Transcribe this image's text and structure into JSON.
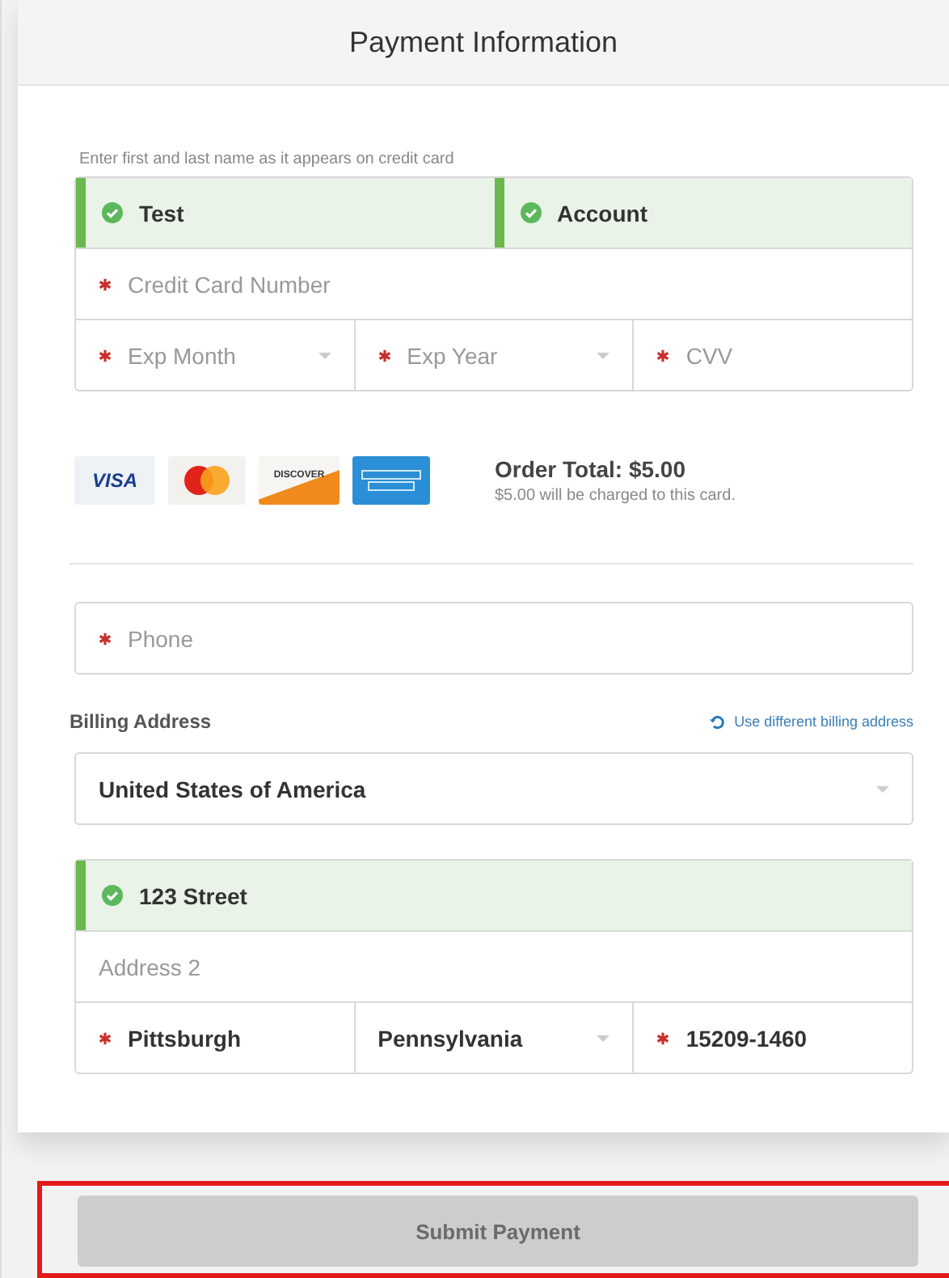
{
  "title": "Payment Information",
  "name_hint": "Enter first and last name as it appears on credit card",
  "card_rows": [
    [
      {
        "value": "Test",
        "required": false,
        "valid": true,
        "dropdown": false
      },
      {
        "value": "Account",
        "required": false,
        "valid": true,
        "dropdown": false
      }
    ],
    [
      {
        "placeholder": "Credit Card Number",
        "required": true,
        "valid": false,
        "dropdown": false
      }
    ],
    [
      {
        "placeholder": "Exp Month",
        "required": true,
        "valid": false,
        "dropdown": true
      },
      {
        "placeholder": "Exp Year",
        "required": true,
        "valid": false,
        "dropdown": true
      },
      {
        "placeholder": "CVV",
        "required": true,
        "valid": false,
        "dropdown": false
      }
    ]
  ],
  "card_logos": [
    {
      "kind": "visa",
      "label": "VISA"
    },
    {
      "kind": "mastercard"
    },
    {
      "kind": "discover",
      "label": "DISCOVER"
    },
    {
      "kind": "amex"
    }
  ],
  "order_total": "Order Total: $5.00",
  "charge_note": "$5.00 will be charged to this card.",
  "phone": {
    "placeholder": "Phone",
    "required": true,
    "valid": false,
    "dropdown": false
  },
  "billing_label": "Billing Address",
  "billing_link": "Use different billing address",
  "country": {
    "value": "United States of America",
    "required": false,
    "valid": false,
    "dropdown": true
  },
  "address_rows": [
    [
      {
        "value": "123 Street",
        "required": false,
        "valid": true,
        "dropdown": false
      }
    ],
    [
      {
        "placeholder": "Address 2",
        "required": false,
        "valid": false,
        "dropdown": false
      }
    ],
    [
      {
        "value": "Pittsburgh",
        "required": true,
        "valid": false,
        "dropdown": false
      },
      {
        "value": "Pennsylvania",
        "required": false,
        "valid": false,
        "dropdown": true
      },
      {
        "value": "15209-1460",
        "required": true,
        "valid": false,
        "dropdown": false
      }
    ]
  ],
  "submit": {
    "label": "Submit Payment",
    "disabled": true,
    "highlighted": true
  }
}
